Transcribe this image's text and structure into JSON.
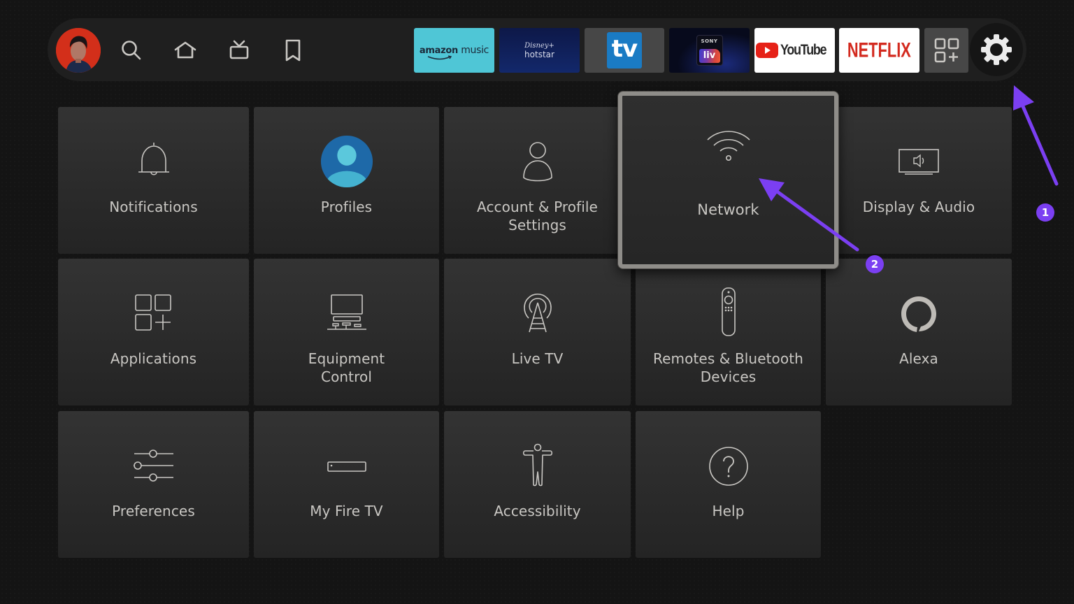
{
  "navbar": {
    "profile_avatar": "user-profile-photo",
    "icons": [
      {
        "name": "search",
        "label": "Search"
      },
      {
        "name": "home",
        "label": "Home"
      },
      {
        "name": "live-tv",
        "label": "Live"
      },
      {
        "name": "watchlist",
        "label": "Watchlist"
      }
    ],
    "apps": [
      {
        "name": "amazon-music",
        "logo_text_1": "amazon",
        "logo_text_2": "music",
        "bg": "#4fc6d6"
      },
      {
        "name": "disney-hotstar",
        "logo_text_1": "Disney+",
        "logo_text_2": "hotstar",
        "bg": "#13286b"
      },
      {
        "name": "tv-app",
        "logo_text_1": "tv",
        "bg": "#1a7bc4"
      },
      {
        "name": "sony-liv",
        "logo_text_1": "SONY",
        "logo_text_2": "liv",
        "bg": "#070a1c"
      },
      {
        "name": "youtube",
        "logo_text_1": "YouTube",
        "bg": "#ffffff"
      },
      {
        "name": "netflix",
        "logo_text_1": "NETFLIX",
        "bg": "#ffffff"
      }
    ],
    "all_apps_label": "All apps",
    "settings_label": "Settings"
  },
  "settings_grid": {
    "focused_item": "Network",
    "items": [
      {
        "id": "notifications",
        "label": "Notifications",
        "icon": "bell-icon"
      },
      {
        "id": "profiles",
        "label": "Profiles",
        "icon": "profile-avatar-icon"
      },
      {
        "id": "account",
        "label": "Account & Profile Settings",
        "line1": "Account & Profile",
        "line2": "Settings",
        "icon": "person-icon"
      },
      {
        "id": "network",
        "label": "Network",
        "icon": "wifi-icon",
        "focused": true
      },
      {
        "id": "display-audio",
        "label": "Display & Audio",
        "icon": "tv-speaker-icon"
      },
      {
        "id": "applications",
        "label": "Applications",
        "icon": "apps-grid-icon"
      },
      {
        "id": "equipment",
        "label": "Equipment Control",
        "line1": "Equipment",
        "line2": "Control",
        "icon": "equipment-icon"
      },
      {
        "id": "live-tv",
        "label": "Live TV",
        "icon": "antenna-icon"
      },
      {
        "id": "remotes",
        "label": "Remotes & Bluetooth Devices",
        "line1": "Remotes & Bluetooth",
        "line2": "Devices",
        "icon": "remote-icon"
      },
      {
        "id": "alexa",
        "label": "Alexa",
        "icon": "alexa-ring-icon"
      },
      {
        "id": "preferences",
        "label": "Preferences",
        "icon": "sliders-icon"
      },
      {
        "id": "my-fire-tv",
        "label": "My Fire TV",
        "icon": "fire-tv-device-icon"
      },
      {
        "id": "accessibility",
        "label": "Accessibility",
        "icon": "accessibility-icon"
      },
      {
        "id": "help",
        "label": "Help",
        "icon": "help-circle-icon"
      }
    ]
  },
  "annotations": {
    "color": "#7b3ff2",
    "steps": [
      {
        "number": "1",
        "target": "settings-gear"
      },
      {
        "number": "2",
        "target": "network-tile"
      }
    ]
  },
  "colors": {
    "background": "#141414",
    "navbar": "#1f1f1f",
    "tile_text": "#c9c7c3",
    "focus_border": "#8f8d89",
    "annotation": "#7b3ff2"
  }
}
